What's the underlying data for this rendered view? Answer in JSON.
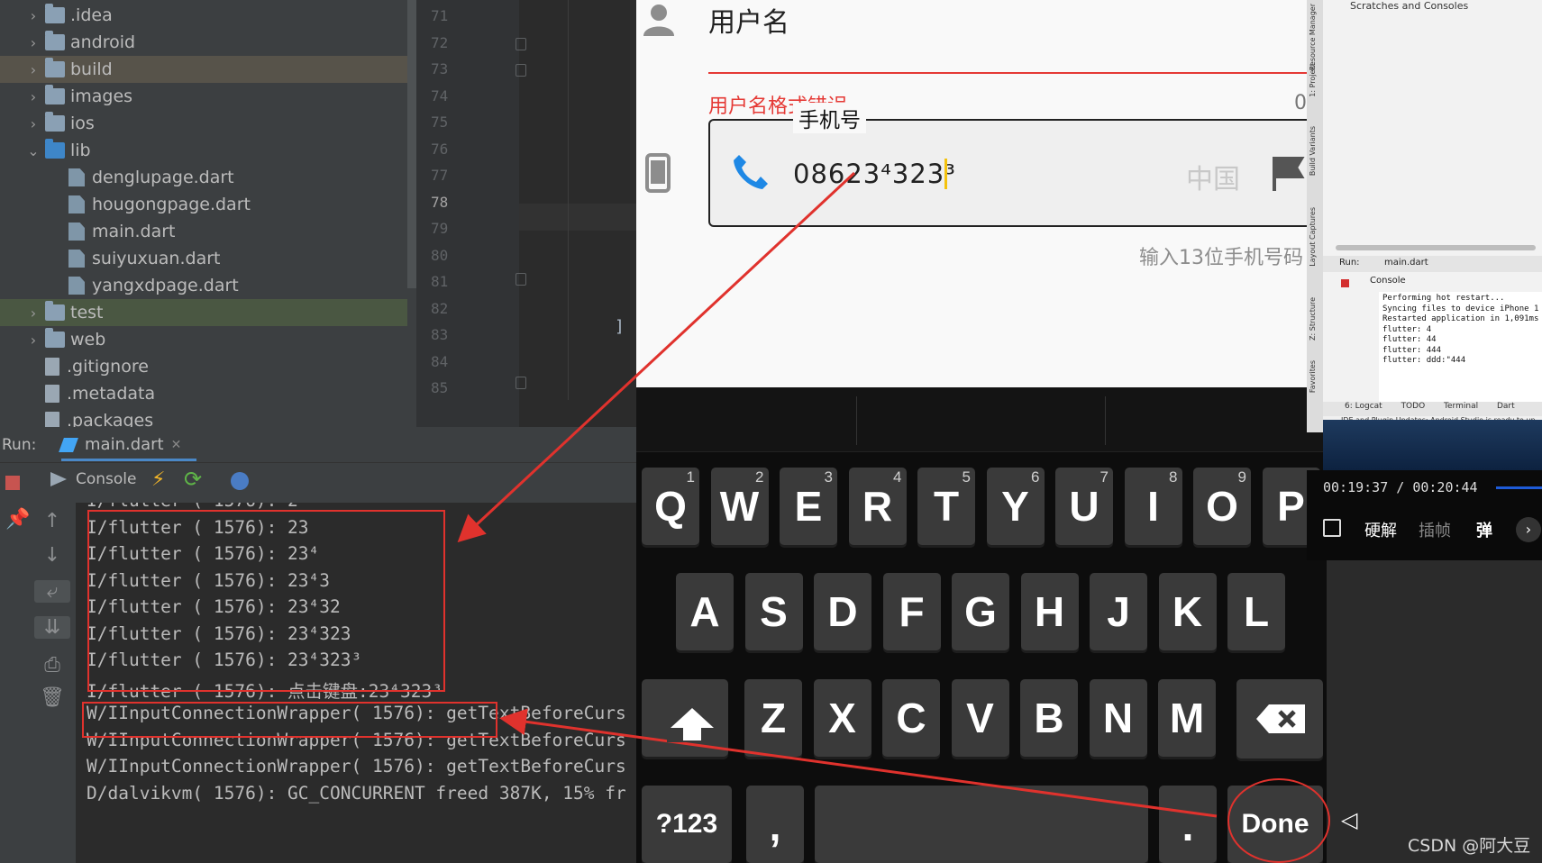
{
  "project_tree": {
    "items": [
      {
        "label": ".idea",
        "type": "folder",
        "expandable": true
      },
      {
        "label": "android",
        "type": "folder",
        "expandable": true
      },
      {
        "label": "build",
        "type": "folder",
        "expandable": true
      },
      {
        "label": "images",
        "type": "folder",
        "expandable": true
      },
      {
        "label": "ios",
        "type": "folder",
        "expandable": true
      },
      {
        "label": "lib",
        "type": "folder",
        "expandable": true
      },
      {
        "label": "denglupage.dart",
        "type": "dart-file"
      },
      {
        "label": "hougongpage.dart",
        "type": "dart-file"
      },
      {
        "label": "main.dart",
        "type": "dart-file"
      },
      {
        "label": "suiyuxuan.dart",
        "type": "dart-file"
      },
      {
        "label": "yangxdpage.dart",
        "type": "dart-file"
      },
      {
        "label": "test",
        "type": "folder",
        "expandable": true
      },
      {
        "label": "web",
        "type": "folder",
        "expandable": true
      },
      {
        "label": ".gitignore",
        "type": "file"
      },
      {
        "label": ".metadata",
        "type": "file"
      },
      {
        "label": ".packages",
        "type": "file"
      }
    ]
  },
  "editor": {
    "line_numbers": [
      "71",
      "72",
      "73",
      "74",
      "75",
      "76",
      "77",
      "78",
      "79",
      "80",
      "81",
      "82",
      "83",
      "84",
      "85"
    ],
    "current_line": "78",
    "visible_code": "]"
  },
  "run_panel": {
    "label": "Run:",
    "tab": "main.dart",
    "console_label": "Console",
    "console_lines": [
      "I/flutter ( 1576): 2",
      "I/flutter ( 1576): 23",
      "I/flutter ( 1576): 23⁴",
      "I/flutter ( 1576): 23⁴3",
      "I/flutter ( 1576): 23⁴32",
      "I/flutter ( 1576): 23⁴323",
      "I/flutter ( 1576): 23⁴323³",
      "I/flutter ( 1576): 点击键盘:23⁴323³",
      "W/IInputConnectionWrapper( 1576): getTextBeforeCurs",
      "W/IInputConnectionWrapper( 1576): getTextBeforeCurs",
      "W/IInputConnectionWrapper( 1576): getTextBeforeCurs",
      "D/dalvikvm( 1576): GC_CONCURRENT freed 387K, 15% fr"
    ]
  },
  "phone_app": {
    "username_label": "用户名",
    "username_error": "用户名格式错误",
    "username_counter": "0",
    "phone_label": "手机号",
    "phone_value": "086234323³",
    "phone_prefix_display": "08623⁴323³",
    "country": "中国",
    "phone_hint": "输入13位手机号码"
  },
  "keyboard": {
    "row1": [
      {
        "k": "Q",
        "n": "1"
      },
      {
        "k": "W",
        "n": "2"
      },
      {
        "k": "E",
        "n": "3"
      },
      {
        "k": "R",
        "n": "4"
      },
      {
        "k": "T",
        "n": "5"
      },
      {
        "k": "Y",
        "n": "6"
      },
      {
        "k": "U",
        "n": "7"
      },
      {
        "k": "I",
        "n": "8"
      },
      {
        "k": "O",
        "n": "9"
      },
      {
        "k": "P",
        "n": ""
      }
    ],
    "row2": [
      "A",
      "S",
      "D",
      "F",
      "G",
      "H",
      "J",
      "K",
      "L"
    ],
    "row3": [
      "Z",
      "X",
      "C",
      "V",
      "B",
      "N",
      "M"
    ],
    "symbols_key": "?123",
    "comma_key": ",",
    "period_key": ".",
    "done_key": "Done"
  },
  "right_ide": {
    "scratches": "Scratches and Consoles",
    "side_tabs": [
      "Resource Manager",
      "1: Project",
      "Build Variants",
      "Layout Captures",
      "Z: Structure",
      "Favorites"
    ],
    "run_label": "Run:",
    "run_tab": "main.dart",
    "console_label": "Console",
    "console_lines": [
      "Performing hot restart...",
      "Syncing files to device iPhone 1",
      "Restarted application in 1,091ms",
      "flutter: 4",
      "flutter: 44",
      "flutter: 444",
      "flutter: ddd:\"444"
    ],
    "bottom_tabs": [
      "6: Logcat",
      "TODO",
      "Terminal",
      "Dart"
    ],
    "status": "IDE and Plugin Updates: Android Studio is ready to up"
  },
  "media_player": {
    "time": "00:19:37 / 00:20:44",
    "buttons": [
      "硬解",
      "插帧",
      "弹"
    ]
  },
  "watermark": "CSDN @阿大豆",
  "colors": {
    "error_red": "#e53935",
    "annotation_red": "#e0322d",
    "accent_blue": "#1e88e5"
  }
}
